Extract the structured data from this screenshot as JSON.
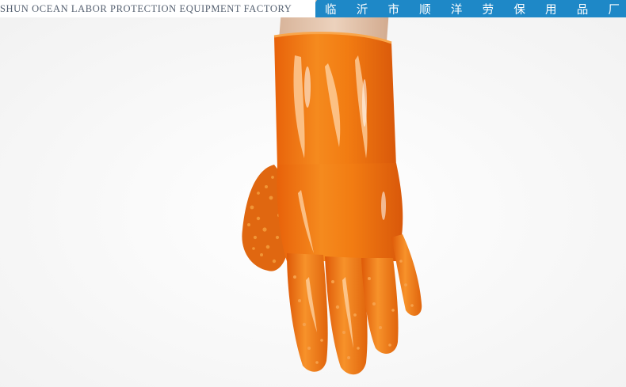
{
  "banner": {
    "english": "SHUN OCEAN LABOR PROTECTION EQUIPMENT FACTORY",
    "chinese": [
      "临",
      "沂",
      "市",
      "顺",
      "洋",
      "劳",
      "保",
      "用",
      "品",
      "厂"
    ],
    "accent": "#1e88c7"
  },
  "product": {
    "glove_color": "#f07a12",
    "background": "#ffffff"
  }
}
